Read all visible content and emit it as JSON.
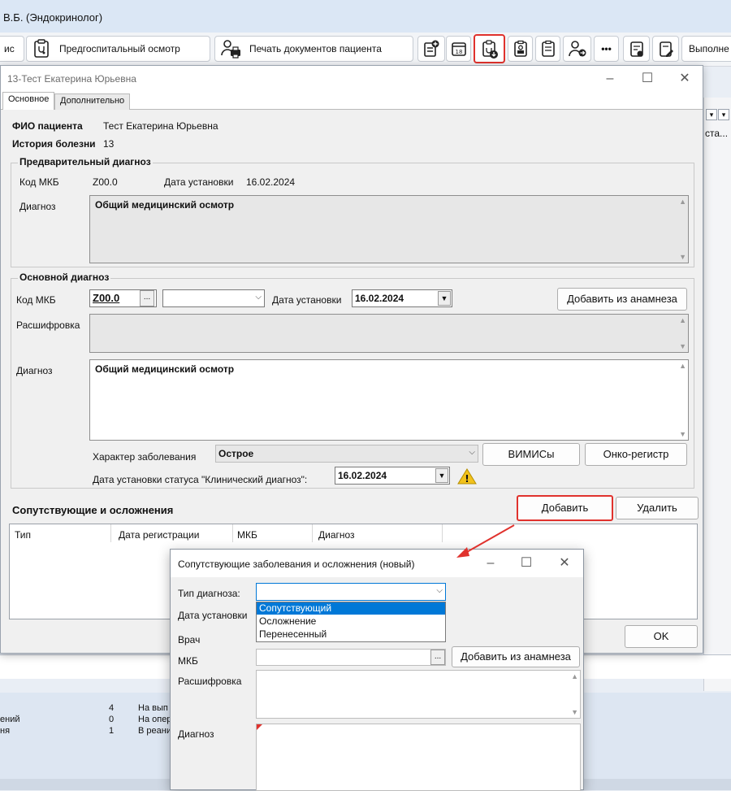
{
  "app": {
    "title": "В.Б. (Эндокринолог)"
  },
  "toolbar": {
    "partial_left": "ис",
    "preop_label": "Предгоспитальный осмотр",
    "print_label": "Печать документов пациента",
    "calendar_label": "18",
    "more_label": "•••",
    "partial_right": "Выполне"
  },
  "background": {
    "right_text": "ста...",
    "bottom_rows": [
      {
        "left": "",
        "count": "4",
        "text": "На вып"
      },
      {
        "left": "ений",
        "count": "0",
        "text": "На опер"
      },
      {
        "left": "ня",
        "count": "1",
        "text": "В реани"
      }
    ]
  },
  "patient_window": {
    "title": "13-Тест Екатерина Юрьевна",
    "tabs": [
      "Основное",
      "Дополнительно"
    ],
    "fio_label": "ФИО пациента",
    "fio_value": "Тест Екатерина Юрьевна",
    "history_label": "История болезни",
    "history_value": "13",
    "prelim": {
      "title": "Предварительный диагноз",
      "mkb_label": "Код МКБ",
      "mkb_value": "Z00.0",
      "date_label": "Дата установки",
      "date_value": "16.02.2024",
      "diag_label": "Диагноз",
      "diag_value": "Общий медицинский осмотр"
    },
    "main": {
      "title": "Основной диагноз",
      "mkb_label": "Код МКБ",
      "mkb_value": "Z00.0",
      "dots": "...",
      "date_label": "Дата установки",
      "date_value": "16.02.2024",
      "add_anamnesis": "Добавить из анамнеза",
      "decode_label": "Расшифровка",
      "diag_label": "Диагноз",
      "diag_value": "Общий медицинский осмотр",
      "character_label": "Характер заболевания",
      "character_value": "Острое",
      "vimis": "ВИМИСы",
      "onko": "Онко-регистр",
      "clinical_date_label": "Дата установки статуса \"Клинический диагноз\":",
      "clinical_date_value": "16.02.2024",
      "warning_icon": "!"
    },
    "comorb": {
      "title": "Сопутствующие и осложнения",
      "add": "Добавить",
      "delete": "Удалить",
      "columns": [
        "Тип",
        "Дата регистрации",
        "МКБ",
        "Диагноз"
      ]
    },
    "ok": "OK"
  },
  "dialog": {
    "title": "Сопутствующие заболевания и осложнения (новый)",
    "type_label": "Тип диагноза:",
    "type_value": "",
    "options": [
      "Сопутствующий",
      "Осложнение",
      "Перенесенный"
    ],
    "selected_option": 0,
    "date_label": "Дата установки",
    "doctor_label": "Врач",
    "mkb_label": "МКБ",
    "dots": "...",
    "add_anamnesis": "Добавить из анамнеза",
    "decode_label": "Расшифровка",
    "diag_label": "Диагноз"
  },
  "colors": {
    "highlight": "#e0322d",
    "selection": "#0078d7",
    "warning": "#f2c21b"
  }
}
